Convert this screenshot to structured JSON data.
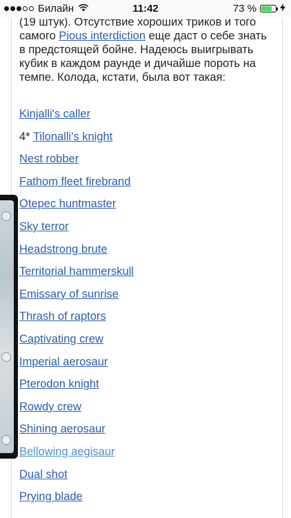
{
  "status_bar": {
    "carrier": "Билайн",
    "time": "11:42",
    "battery_percent": "73 %",
    "battery_level": 0.73
  },
  "article": {
    "intro_part1": "(19 штук). Отсутствие хороших триков и того самого ",
    "intro_link": "Pious interdiction",
    "intro_part2": " еще даст о себе знать в предстоящей бойне. Надеюсь выигрывать кубик в каждом раунде и дичайше пороть на темпе. Колода, кстати, была вот такая:"
  },
  "cards": [
    {
      "qty": "",
      "name": "Kinjalli's caller"
    },
    {
      "qty": "4* ",
      "name": "Tilonalli's knight"
    },
    {
      "qty": "",
      "name": "Nest robber"
    },
    {
      "qty": "",
      "name": "Fathom fleet firebrand"
    },
    {
      "qty": "",
      "name": "Otepec huntmaster"
    },
    {
      "qty": "",
      "name": "Sky terror"
    },
    {
      "qty": "",
      "name": "Headstrong brute"
    },
    {
      "qty": "",
      "name": "Territorial hammerskull"
    },
    {
      "qty": "",
      "name": "Emissary of sunrise"
    },
    {
      "qty": "",
      "name": "Thrash of raptors"
    },
    {
      "qty": "",
      "name": "Captivating crew"
    },
    {
      "qty": "",
      "name": "Imperial aerosaur"
    },
    {
      "qty": "",
      "name": "Pterodon knight"
    },
    {
      "qty": "",
      "name": "Rowdy crew"
    },
    {
      "qty": "",
      "name": "Shining aerosaur"
    },
    {
      "qty": "",
      "name": "Bellowing aegisaur"
    },
    {
      "qty": "",
      "name": "Dual shot"
    },
    {
      "qty": "",
      "name": "Prying blade"
    }
  ],
  "colors": {
    "link": "#2a5db0",
    "visited_link": "#4a8fd0",
    "frame_border": "#e3d6c8"
  }
}
